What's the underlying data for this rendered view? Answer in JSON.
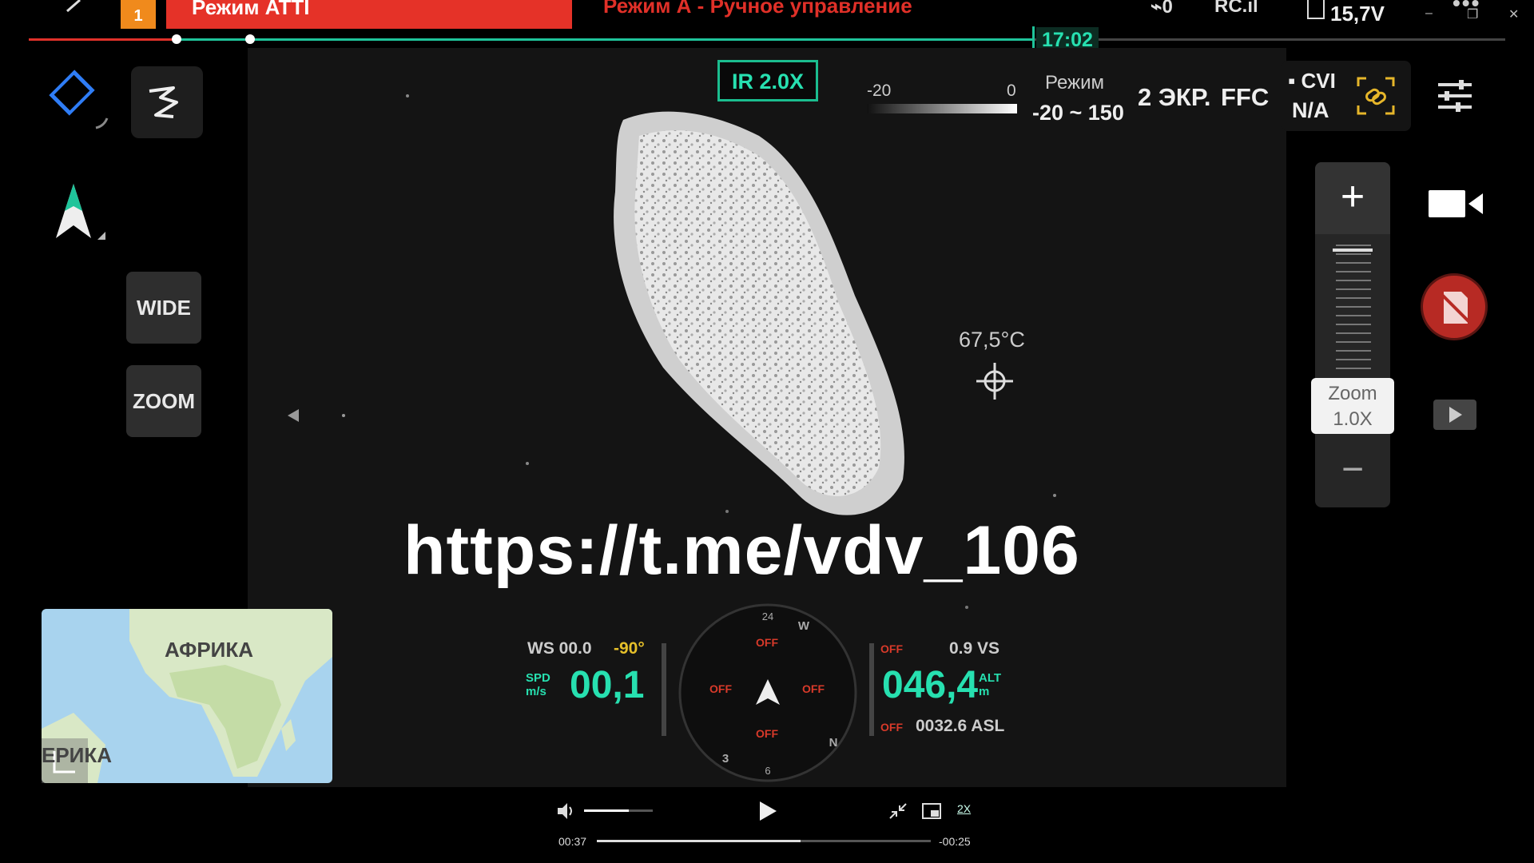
{
  "window": {
    "mode_banner": "Режим ATTI",
    "warning_badge": "1",
    "mode_description": "Режим А - Ручное управление",
    "signal_value": "0",
    "rc_label": "RC",
    "battery_voltage": "15,7V",
    "minimize_glyph": "–",
    "restore_glyph": "❐",
    "close_glyph": "✕",
    "more_glyph": "•••"
  },
  "timeline": {
    "flight_time": "17:02"
  },
  "left_panel": {
    "wide_label": "WIDE",
    "zoom_label": "ZOOM"
  },
  "camera": {
    "ir_zoom": "IR 2.0X",
    "scale_low": "-20",
    "scale_high": "0",
    "mode_label": "Режим",
    "range": "-20 ~ 150",
    "screens": "2 ЭКР.",
    "ffc": "FFC",
    "cvi_label": "CVI",
    "cvi_value": "N/A",
    "spot_temperature": "67,5°C",
    "watermark": "https://t.me/vdv_106"
  },
  "zoom_control": {
    "plus": "+",
    "minus": "−",
    "label": "Zoom",
    "value": "1.0X"
  },
  "map": {
    "label_main": "АФРИКА",
    "label_edge": "ЕРИКА"
  },
  "telemetry": {
    "ws": "WS 00.0",
    "gimbal_tilt": "-90°",
    "spd_unit_top": "SPD",
    "spd_unit_bottom": "m/s",
    "speed": "00,1",
    "vs": "0.9 VS",
    "alt_unit_top": "ALT",
    "alt_unit_bottom": "m",
    "altitude": "046,4",
    "asl": "0032.6 ASL",
    "off": "OFF"
  },
  "player": {
    "current_time": "00:37",
    "remaining_time": "-00:25",
    "speed": "2X",
    "progress": 0.61,
    "volume": 0.65
  },
  "colors": {
    "accent_green": "#27e0b0",
    "banner_red": "#e53228",
    "warning_orange": "#f08a1c",
    "tilt_yellow": "#e6c02a"
  }
}
